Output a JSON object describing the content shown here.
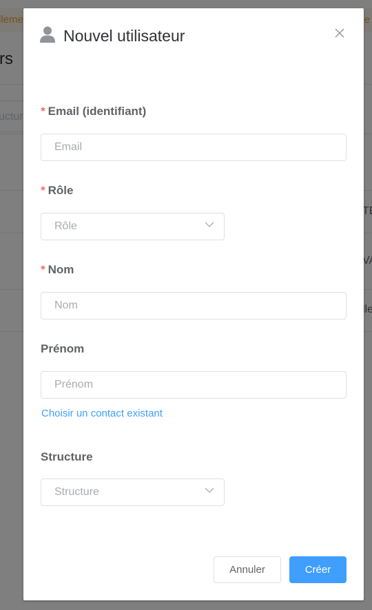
{
  "background": {
    "notice_left": "lleme",
    "notice_right": "lle",
    "heading_fragment": "rs",
    "filter_placeholder_fragment": "ucture",
    "cells": [
      "TE",
      "VA",
      "lle"
    ]
  },
  "dialog": {
    "title": "Nouvel utilisateur",
    "fields": {
      "email": {
        "label": "Email (identifiant)",
        "placeholder": "Email",
        "required": true
      },
      "role": {
        "label": "Rôle",
        "placeholder": "Rôle",
        "required": true
      },
      "nom": {
        "label": "Nom",
        "placeholder": "Nom",
        "required": true
      },
      "prenom": {
        "label": "Prénom",
        "placeholder": "Prénom",
        "required": false
      },
      "structure": {
        "label": "Structure",
        "placeholder": "Structure",
        "required": false
      }
    },
    "required_marker": "*",
    "contact_link": "Choisir un contact existant",
    "buttons": {
      "cancel": "Annuler",
      "create": "Créer"
    }
  },
  "icons": {
    "user": "user-icon",
    "close": "close-icon",
    "chevron": "chevron-down-icon"
  },
  "colors": {
    "primary": "#409eff",
    "required": "#f56c6c",
    "notice": "#e6a23c",
    "overlay": "rgba(0,0,0,0.5)"
  }
}
